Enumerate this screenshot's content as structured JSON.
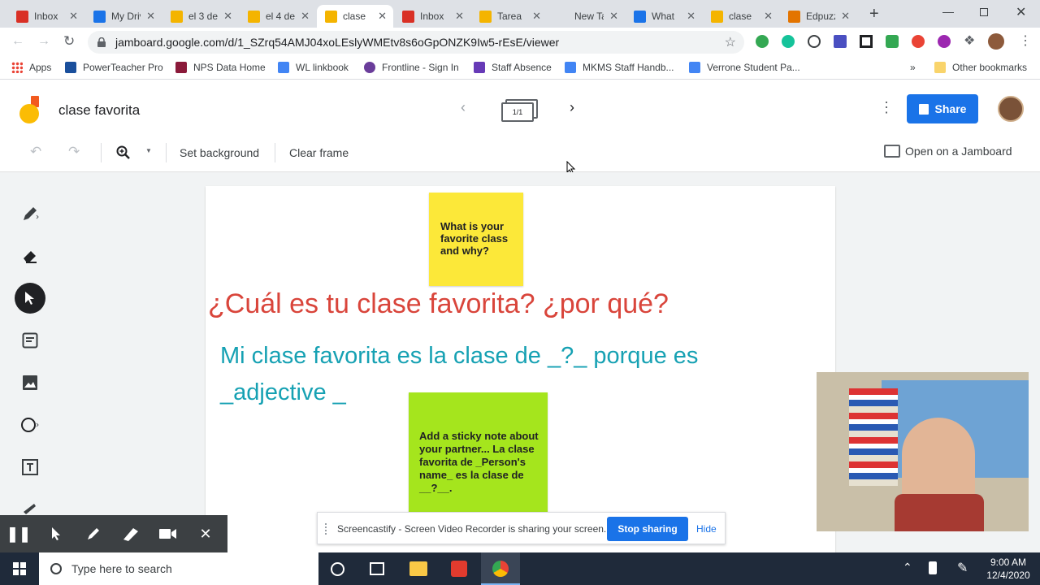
{
  "browser": {
    "tabs": [
      {
        "title": "Inbox",
        "icon": "gmail-icon",
        "color": "#d93025"
      },
      {
        "title": "My Drive",
        "icon": "drive-icon",
        "color": "#1a73e8"
      },
      {
        "title": "el 3 de",
        "icon": "slides-icon",
        "color": "#f4b400"
      },
      {
        "title": "el 4 de",
        "icon": "slides-icon",
        "color": "#f4b400"
      },
      {
        "title": "clase",
        "icon": "jamboard-icon",
        "color": "#f4b400"
      },
      {
        "title": "Inbox",
        "icon": "gmail-icon",
        "color": "#d93025"
      },
      {
        "title": "Tarea",
        "icon": "jamboard-icon",
        "color": "#f4b400"
      },
      {
        "title": "New Tab",
        "icon": "",
        "color": "#5f6368"
      },
      {
        "title": "What",
        "icon": "info-icon",
        "color": "#1a73e8"
      },
      {
        "title": "clase",
        "icon": "jamboard-icon",
        "color": "#f4b400"
      },
      {
        "title": "Edpuzzle",
        "icon": "edpuzzle-icon",
        "color": "#e37400"
      }
    ],
    "new_tab": "+",
    "url": "jamboard.google.com/d/1_SZrq54AMJ04xoLEslyWMEtv8s6oGpONZK9Iw5-rEsE/viewer",
    "bookmarks": [
      "Apps",
      "PowerTeacher Pro",
      "NPS Data Home",
      "WL linkbook",
      "Frontline - Sign In",
      "Staff Absence",
      "MKMS Staff Handb...",
      "Verrone Student Pa..."
    ],
    "other_bookmarks": "Other bookmarks",
    "overflow": "»"
  },
  "jamboard": {
    "title": "clase favorita",
    "frame_counter": "1/1",
    "share_label": "Share",
    "toolbar": {
      "set_background": "Set background",
      "clear_frame": "Clear frame",
      "open_on_jamboard": "Open on a Jamboard"
    },
    "board": {
      "sticky1": "What is your favorite class and why?",
      "sticky2": "Add a sticky note about your partner... La clase favorita de _Person's name_ es la clase de __?__.",
      "heading": "¿Cuál es tu clase favorita? ¿por qué?",
      "sentence_line1": "Mi clase favorita es la clase de _?_ porque es",
      "sentence_line2": "_adjective _"
    },
    "colors": {
      "heading": "#d9453b",
      "sentence": "#16a1b3",
      "sticky_yellow": "#fce839",
      "sticky_green": "#a5e51d",
      "share": "#1a73e8"
    }
  },
  "screencastify": {
    "message": "Screencastify - Screen Video Recorder is sharing your screen.",
    "stop_label": "Stop sharing",
    "hide_label": "Hide"
  },
  "taskbar": {
    "search_placeholder": "Type here to search",
    "time": "9:00 AM",
    "date": "12/4/2020"
  }
}
